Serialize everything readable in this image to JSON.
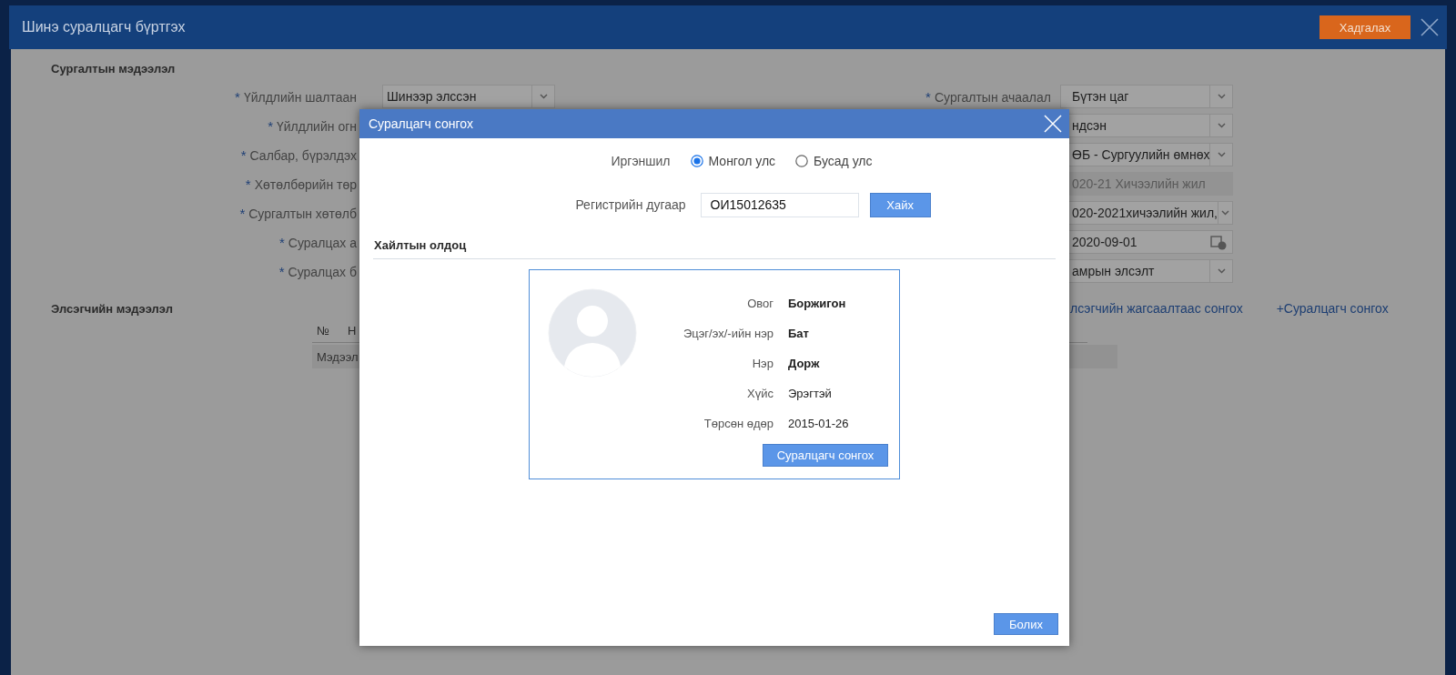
{
  "window": {
    "title": "Шинэ суралцагч бүртгэх",
    "save_button": "Хадгалах"
  },
  "form": {
    "section_title": "Сургалтын мэдээлэл",
    "rows": [
      {
        "left": {
          "mark": "*",
          "label": "Үйлдлийн шалтаан",
          "value": "Шинээр элссэн",
          "kind": "select"
        },
        "right": {
          "mark": "*",
          "label": "Сургалтын ачаалал",
          "value": "Бүтэн цаг",
          "kind": "select"
        }
      },
      {
        "left": {
          "mark": "*",
          "label": "Үйлдлийн огн"
        },
        "right": {
          "value": "ндсэн",
          "kind": "select"
        }
      },
      {
        "left": {
          "mark": "*",
          "label": "Салбар, бүрэлдэх"
        },
        "right": {
          "value": "ӨБ - Сургуулийн өмнөх",
          "kind": "select"
        }
      },
      {
        "left": {
          "mark": "*",
          "label": "Хөтөлбөрийн төр"
        },
        "right": {
          "value": "020-21 Хичээлийн жил",
          "kind": "text",
          "disabled": true
        }
      },
      {
        "left": {
          "mark": "*",
          "label": "Сургалтын хөтөлб"
        },
        "right": {
          "value": "020-2021хичээлийн жил,",
          "kind": "select"
        }
      },
      {
        "left": {
          "mark": "*",
          "label": "Суралцах а"
        },
        "right": {
          "value": "2020-09-01",
          "kind": "date"
        }
      },
      {
        "left": {
          "mark": "*",
          "label": "Суралцах б"
        },
        "right": {
          "value": "амрын элсэлт",
          "kind": "select"
        }
      }
    ]
  },
  "applicant": {
    "section_title": "Элсэгчийн мэдээлэл",
    "links": [
      "лсэгчийн жагсаалтаас сонгох",
      "+Суралцагч сонгох"
    ],
    "table": {
      "columns": [
        "№",
        "Н"
      ],
      "rows": [
        [
          "Мэдээл"
        ]
      ]
    }
  },
  "dialog": {
    "title": "Суралцагч сонгох",
    "citizenship": {
      "label": "Иргэншил",
      "options": [
        {
          "label": "Монгол улс",
          "selected": true
        },
        {
          "label": "Бусад улс",
          "selected": false
        }
      ]
    },
    "register": {
      "label": "Регистрийн дугаар",
      "value": "ОИ15012635",
      "button": "Хайх"
    },
    "results_title": "Хайлтын олдоц",
    "result": {
      "fields": [
        {
          "label": "Овог",
          "value": "Боржигон",
          "bold": true
        },
        {
          "label": "Эцэг/эх/-ийн нэр",
          "value": "Бат",
          "bold": true
        },
        {
          "label": "Нэр",
          "value": "Дорж",
          "bold": true
        },
        {
          "label": "Хүйс",
          "value": "Эрэгтэй",
          "bold": false
        },
        {
          "label": "Төрсөн өдөр",
          "value": "2015-01-26",
          "bold": false
        }
      ],
      "button": "Суралцагч сонгох"
    },
    "cancel_button": "Болих"
  }
}
